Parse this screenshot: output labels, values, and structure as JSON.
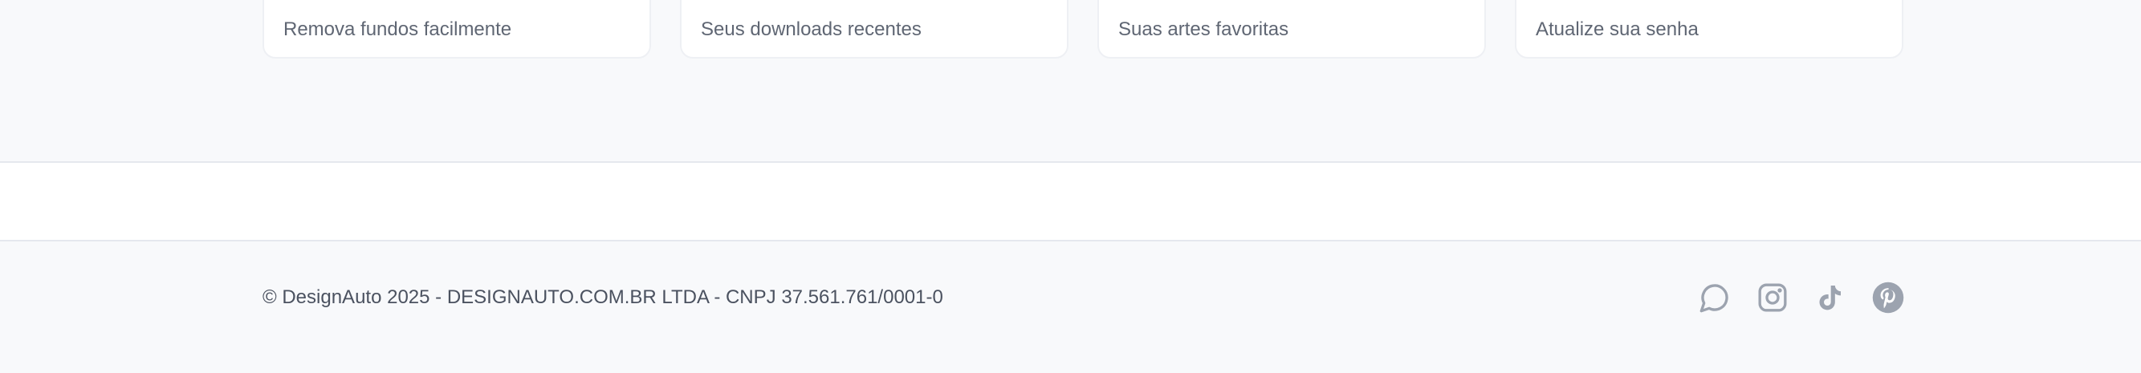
{
  "cards": [
    {
      "description": "Remova fundos facilmente"
    },
    {
      "description": "Seus downloads recentes"
    },
    {
      "description": "Suas artes favoritas"
    },
    {
      "description": "Atualize sua senha"
    }
  ],
  "footer": {
    "copyright": "© DesignAuto 2025 - DESIGNAUTO.COM.BR LTDA - CNPJ 37.561.761/0001-0",
    "social_icons": [
      "chat-icon",
      "instagram-icon",
      "tiktok-icon",
      "pinterest-icon"
    ]
  },
  "colors": {
    "background": "#f8f9fb",
    "card_background": "#ffffff",
    "text_muted": "#5f6673",
    "icon": "#9ca3af"
  }
}
